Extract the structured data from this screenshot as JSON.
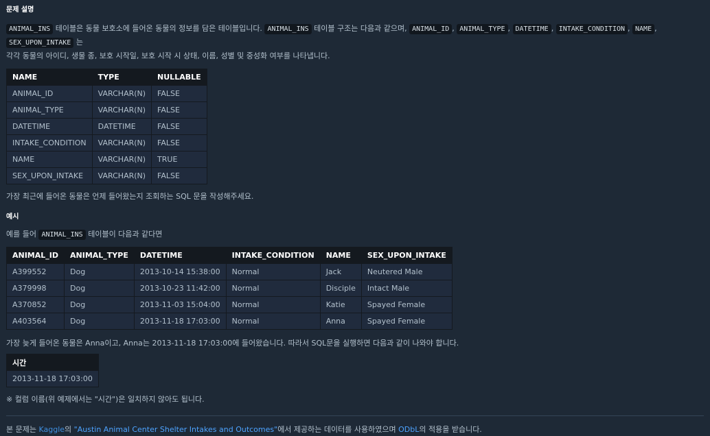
{
  "description": {
    "heading": "문제 설명",
    "intro_parts": {
      "table_code": "ANIMAL_INS",
      "text1": "테이블은 동물 보호소에 들어온 동물의 정보를 담은 테이블입니다.",
      "table_code2": "ANIMAL_INS",
      "text2": "테이블 구조는 다음과 같으며,",
      "columns": [
        "ANIMAL_ID",
        "ANIMAL_TYPE",
        "DATETIME",
        "INTAKE_CONDITION",
        "NAME",
        "SEX_UPON_INTAKE"
      ],
      "text3": "는",
      "line2": "각각 동물의 아이디, 생물 종, 보호 시작일, 보호 시작 시 상태, 이름, 성별 및 중성화 여부를 나타냅니다."
    },
    "schema_table": {
      "headers": [
        "NAME",
        "TYPE",
        "NULLABLE"
      ],
      "rows": [
        [
          "ANIMAL_ID",
          "VARCHAR(N)",
          "FALSE"
        ],
        [
          "ANIMAL_TYPE",
          "VARCHAR(N)",
          "FALSE"
        ],
        [
          "DATETIME",
          "DATETIME",
          "FALSE"
        ],
        [
          "INTAKE_CONDITION",
          "VARCHAR(N)",
          "FALSE"
        ],
        [
          "NAME",
          "VARCHAR(N)",
          "TRUE"
        ],
        [
          "SEX_UPON_INTAKE",
          "VARCHAR(N)",
          "FALSE"
        ]
      ]
    },
    "question": "가장 최근에 들어온 동물은 언제 들어왔는지 조회하는 SQL 문을 작성해주세요."
  },
  "example": {
    "heading": "예시",
    "lead_prefix": "예를 들어",
    "lead_code": "ANIMAL_INS",
    "lead_suffix": "테이블이 다음과 같다면",
    "data_table": {
      "headers": [
        "ANIMAL_ID",
        "ANIMAL_TYPE",
        "DATETIME",
        "INTAKE_CONDITION",
        "NAME",
        "SEX_UPON_INTAKE"
      ],
      "rows": [
        [
          "A399552",
          "Dog",
          "2013-10-14 15:38:00",
          "Normal",
          "Jack",
          "Neutered Male"
        ],
        [
          "A379998",
          "Dog",
          "2013-10-23 11:42:00",
          "Normal",
          "Disciple",
          "Intact Male"
        ],
        [
          "A370852",
          "Dog",
          "2013-11-03 15:04:00",
          "Normal",
          "Katie",
          "Spayed Female"
        ],
        [
          "A403564",
          "Dog",
          "2013-11-18 17:03:00",
          "Normal",
          "Anna",
          "Spayed Female"
        ]
      ]
    },
    "explanation": "가장 늦게 들어온 동물은 Anna이고, Anna는 2013-11-18 17:03:00에 들어왔습니다. 따라서 SQL문을 실행하면 다음과 같이 나와야 합니다.",
    "result_table": {
      "headers": [
        "시간"
      ],
      "rows": [
        [
          "2013-11-18 17:03:00"
        ]
      ]
    },
    "note": "※ 컬럼 이름(위 예제에서는 \"시간\")은 일치하지 않아도 됩니다."
  },
  "footer": {
    "prefix": "본 문제는",
    "kaggle_link": "Kaggle",
    "mid1": "의",
    "dataset_link": "\"Austin Animal Center Shelter Intakes and Outcomes\"",
    "mid2": "에서 제공하는 데이터를 사용하였으며",
    "license_link": "ODbL",
    "suffix": "의 적용을 받습니다."
  },
  "colors": {
    "background": "#1e2936",
    "text": "#b2c0cc",
    "link": "#4da3ff",
    "table_header": "#14191f"
  }
}
